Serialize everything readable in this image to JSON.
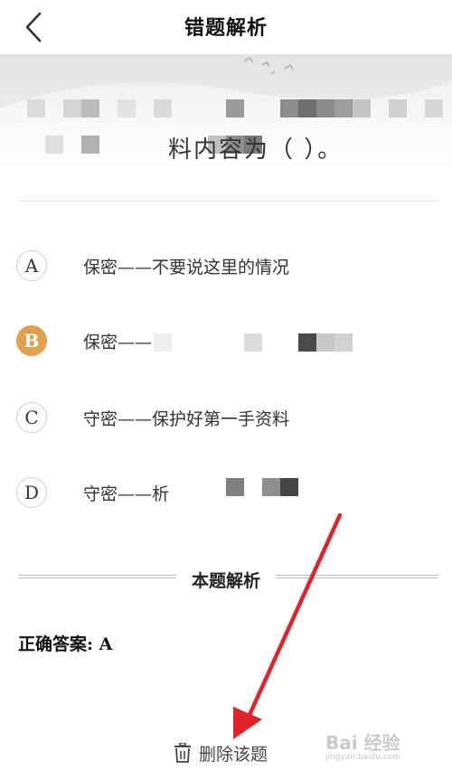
{
  "header": {
    "title": "错题解析"
  },
  "question": {
    "visible_tail": "料内容为（  ）。"
  },
  "options": [
    {
      "letter": "A",
      "text": "保密——不要说这里的情况",
      "state": "normal"
    },
    {
      "letter": "B",
      "text": "保密——",
      "state": "selected-wrong"
    },
    {
      "letter": "C",
      "text": "守密——保护好第一手资料",
      "state": "normal"
    },
    {
      "letter": "D",
      "text": "守密——析",
      "state": "normal"
    }
  ],
  "analysis": {
    "section_title": "本题解析",
    "answer_label": "正确答案:",
    "answer_value": "A"
  },
  "actions": {
    "delete_label": "删除该题"
  },
  "watermark": {
    "text": "Bai 经验",
    "sub": "jingyan.baidu.com"
  },
  "colors": {
    "wrong_badge": "#e1a04e",
    "arrow": "#e0222a"
  }
}
